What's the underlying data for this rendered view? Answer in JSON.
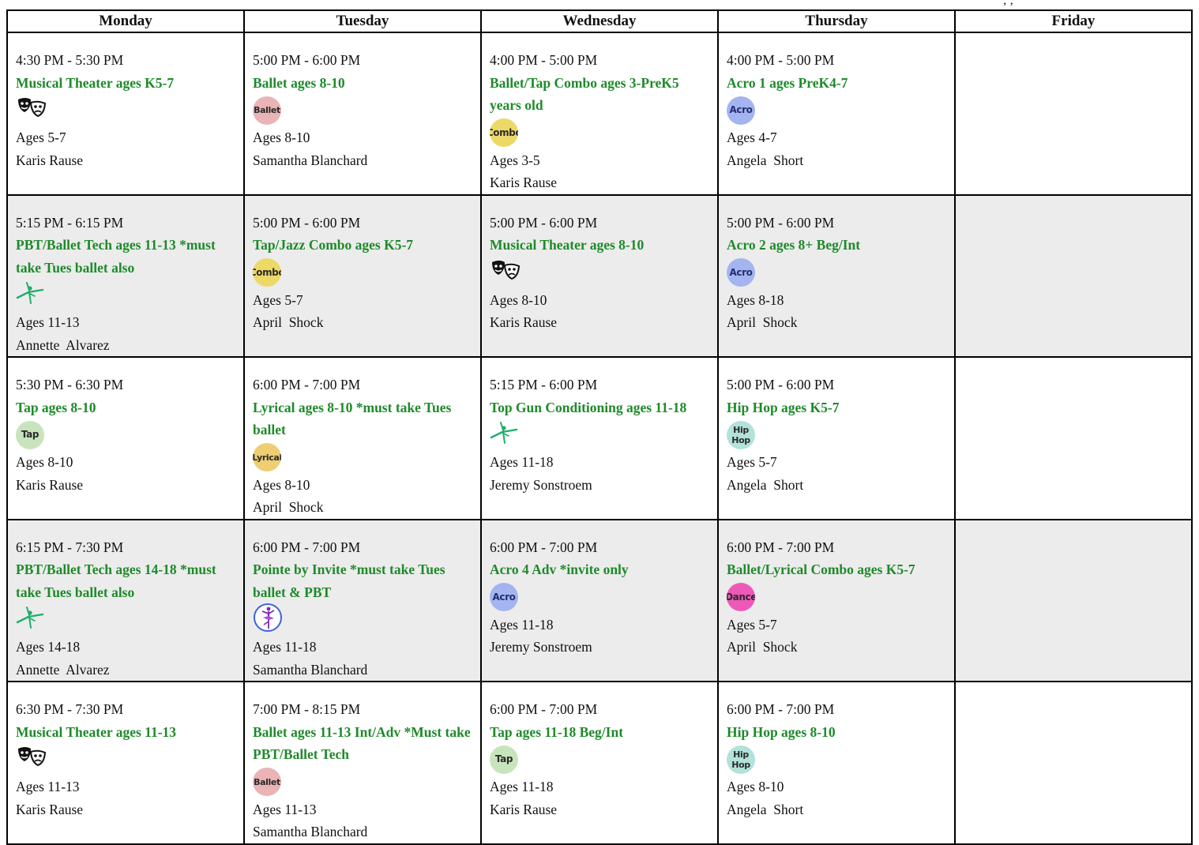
{
  "top_note": "; ;",
  "days": [
    "Monday",
    "Tuesday",
    "Wednesday",
    "Thursday",
    "Friday"
  ],
  "rows": [
    [
      {
        "time": "4:30 PM - 5:30 PM",
        "title": "Musical Theater ages K5-7",
        "icon": "theater-masks-icon",
        "ages": "Ages 5-7",
        "teacher": "Karis Rause"
      },
      {
        "time": "5:00 PM - 6:00 PM",
        "title": "Ballet ages 8-10",
        "icon": "ballet-badge-icon",
        "icon_label": "Ballet",
        "ages": "Ages 8-10",
        "teacher": "Samantha Blanchard"
      },
      {
        "time": "4:00 PM - 5:00 PM",
        "title": "Ballet/Tap Combo ages 3-PreK5 years old",
        "icon": "combo-badge-icon",
        "icon_label": "Combo",
        "ages": "Ages 3-5",
        "teacher": "Karis Rause"
      },
      {
        "time": "4:00 PM - 5:00 PM",
        "title": "Acro 1 ages PreK4-7",
        "icon": "acro-badge-icon",
        "icon_label": "Acro",
        "ages": "Ages 4-7",
        "teacher": "Angela  Short"
      },
      null
    ],
    [
      {
        "time": "5:15 PM - 6:15 PM",
        "title": "PBT/Ballet Tech ages 11-13  *must take Tues ballet also",
        "icon": "leaping-dancer-icon",
        "ages": "Ages 11-13",
        "teacher": "Annette  Alvarez"
      },
      {
        "time": "5:00 PM - 6:00 PM",
        "title": "Tap/Jazz Combo ages K5-7",
        "icon": "combo-badge-icon",
        "icon_label": "Combo",
        "ages": "Ages 5-7",
        "teacher": "April  Shock"
      },
      {
        "time": "5:00 PM - 6:00 PM",
        "title": "Musical Theater ages 8-10",
        "icon": "theater-masks-icon",
        "ages": "Ages 8-10",
        "teacher": "Karis Rause"
      },
      {
        "time": "5:00 PM - 6:00 PM",
        "title": "Acro 2 ages 8+ Beg/Int",
        "icon": "acro-badge-icon",
        "icon_label": "Acro",
        "ages": "Ages 8-18",
        "teacher": "April  Shock"
      },
      null
    ],
    [
      {
        "time": "5:30 PM - 6:30 PM",
        "title": "Tap ages 8-10",
        "icon": "tap-badge-icon",
        "icon_label": "Tap",
        "ages": "Ages 8-10",
        "teacher": "Karis Rause"
      },
      {
        "time": "6:00 PM - 7:00 PM",
        "title": "Lyrical ages 8-10 *must take Tues ballet",
        "icon": "lyrical-badge-icon",
        "icon_label": "Lyrical",
        "ages": "Ages 8-10",
        "teacher": "April  Shock"
      },
      {
        "time": "5:15 PM - 6:00 PM",
        "title": "Top Gun Conditioning ages 11-18",
        "icon": "leaping-dancer-icon",
        "ages": "Ages 11-18",
        "teacher": "Jeremy Sonstroem"
      },
      {
        "time": "5:00 PM - 6:00 PM",
        "title": "Hip Hop ages K5-7",
        "icon": "hiphop-badge-icon",
        "icon_label": "Hip Hop",
        "ages": "Ages 5-7",
        "teacher": "Angela  Short"
      },
      null
    ],
    [
      {
        "time": "6:15 PM - 7:30 PM",
        "title": "PBT/Ballet Tech ages 14-18  *must take Tues ballet also",
        "icon": "leaping-dancer-icon",
        "ages": "Ages 14-18",
        "teacher": "Annette  Alvarez"
      },
      {
        "time": "6:00 PM - 7:00 PM",
        "title": "Pointe by Invite *must take Tues ballet & PBT",
        "icon": "pointe-ballerina-icon",
        "ages": "Ages 11-18",
        "teacher": "Samantha Blanchard"
      },
      {
        "time": "6:00 PM - 7:00 PM",
        "title": "Acro 4 Adv *invite only",
        "icon": "acro-badge-icon",
        "icon_label": "Acro",
        "ages": "Ages 11-18",
        "teacher": "Jeremy Sonstroem"
      },
      {
        "time": "6:00 PM - 7:00 PM",
        "title": "Ballet/Lyrical Combo ages K5-7",
        "icon": "dance-badge-icon",
        "icon_label": "Dance",
        "ages": "Ages 5-7",
        "teacher": "April  Shock"
      },
      null
    ],
    [
      {
        "time": "6:30 PM - 7:30 PM",
        "title": "Musical Theater ages 11-13",
        "icon": "theater-masks-icon",
        "ages": "Ages 11-13",
        "teacher": "Karis Rause"
      },
      {
        "time": "7:00 PM - 8:15 PM",
        "title": "Ballet ages 11-13 Int/Adv *Must take PBT/Ballet Tech",
        "icon": "ballet-badge-icon",
        "icon_label": "Ballet",
        "ages": "Ages 11-13",
        "teacher": "Samantha Blanchard"
      },
      {
        "time": "6:00 PM - 7:00 PM",
        "title": "Tap ages 11-18 Beg/Int",
        "icon": "tap-badge-icon",
        "icon_label": "Tap",
        "ages": "Ages 11-18",
        "teacher": "Karis Rause"
      },
      {
        "time": "6:00 PM - 7:00 PM",
        "title": "Hip Hop ages 8-10",
        "icon": "hiphop-badge-icon",
        "icon_label": "Hip Hop",
        "ages": "Ages 8-10",
        "teacher": "Angela  Short"
      },
      null
    ]
  ]
}
